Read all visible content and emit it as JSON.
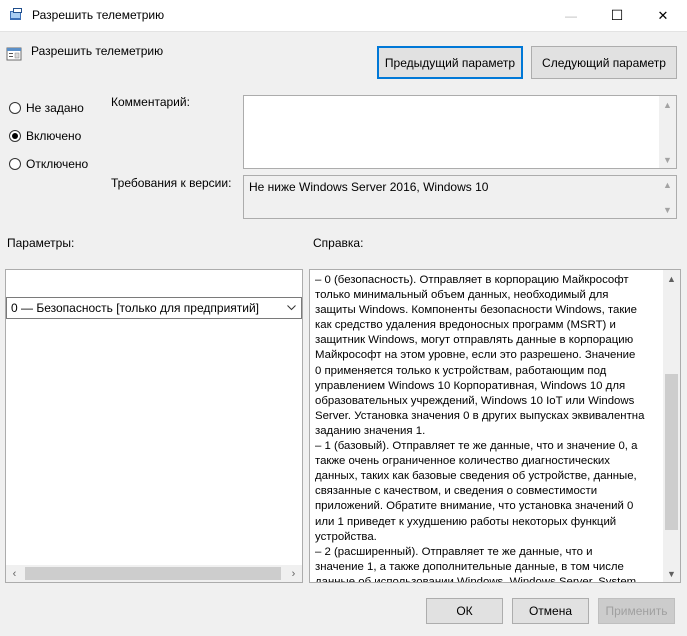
{
  "window": {
    "title": "Разрешить телеметрию",
    "controls": {
      "minimize": "—",
      "maximize": "☐",
      "close": "✕"
    }
  },
  "header": {
    "policy_title": "Разрешить телеметрию",
    "prev_button": "Предыдущий параметр",
    "next_button": "Следующий параметр"
  },
  "state": {
    "options": [
      {
        "label": "Не задано",
        "selected": false
      },
      {
        "label": "Включено",
        "selected": true
      },
      {
        "label": "Отключено",
        "selected": false
      }
    ]
  },
  "comment": {
    "label": "Комментарий:",
    "value": ""
  },
  "requirements": {
    "label": "Требования к версии:",
    "value": "Не ниже Windows Server 2016, Windows 10"
  },
  "params": {
    "label": "Параметры:",
    "dropdown_value": "0 — Безопасность [только для предприятий]"
  },
  "help": {
    "label": "Справка:",
    "lines": [
      "– 0 (безопасность). Отправляет в корпорацию Майкрософт",
      "только минимальный объем данных, необходимый для",
      "защиты Windows. Компоненты безопасности Windows, такие",
      "как средство удаления вредоносных программ (MSRT) и",
      "защитник Windows, могут отправлять данные в корпорацию",
      "Майкрософт на этом уровне, если это разрешено. Значение",
      "0 применяется только к устройствам, работающим под",
      "управлением Windows 10 Корпоративная, Windows 10 для",
      "образовательных учреждений, Windows 10 IoT или Windows",
      "Server. Установка значения 0 в других выпусках эквивалентна",
      "заданию значения 1.",
      "– 1 (базовый). Отправляет те же данные, что и значение 0, а",
      "также очень ограниченное количество диагностических",
      "данных, таких как базовые сведения об устройстве, данные,",
      "связанные с качеством, и сведения о совместимости",
      "приложений. Обратите внимание, что установка значений 0",
      "или 1 приведет к ухудшению работы некоторых функций",
      "устройства.",
      "– 2 (расширенный). Отправляет те же данные, что и",
      "значение 1, а также дополнительные данные, в том числе",
      "данные об использовании Windows, Windows Server, System"
    ]
  },
  "footer": {
    "ok": "ОК",
    "cancel": "Отмена",
    "apply": "Применить"
  }
}
